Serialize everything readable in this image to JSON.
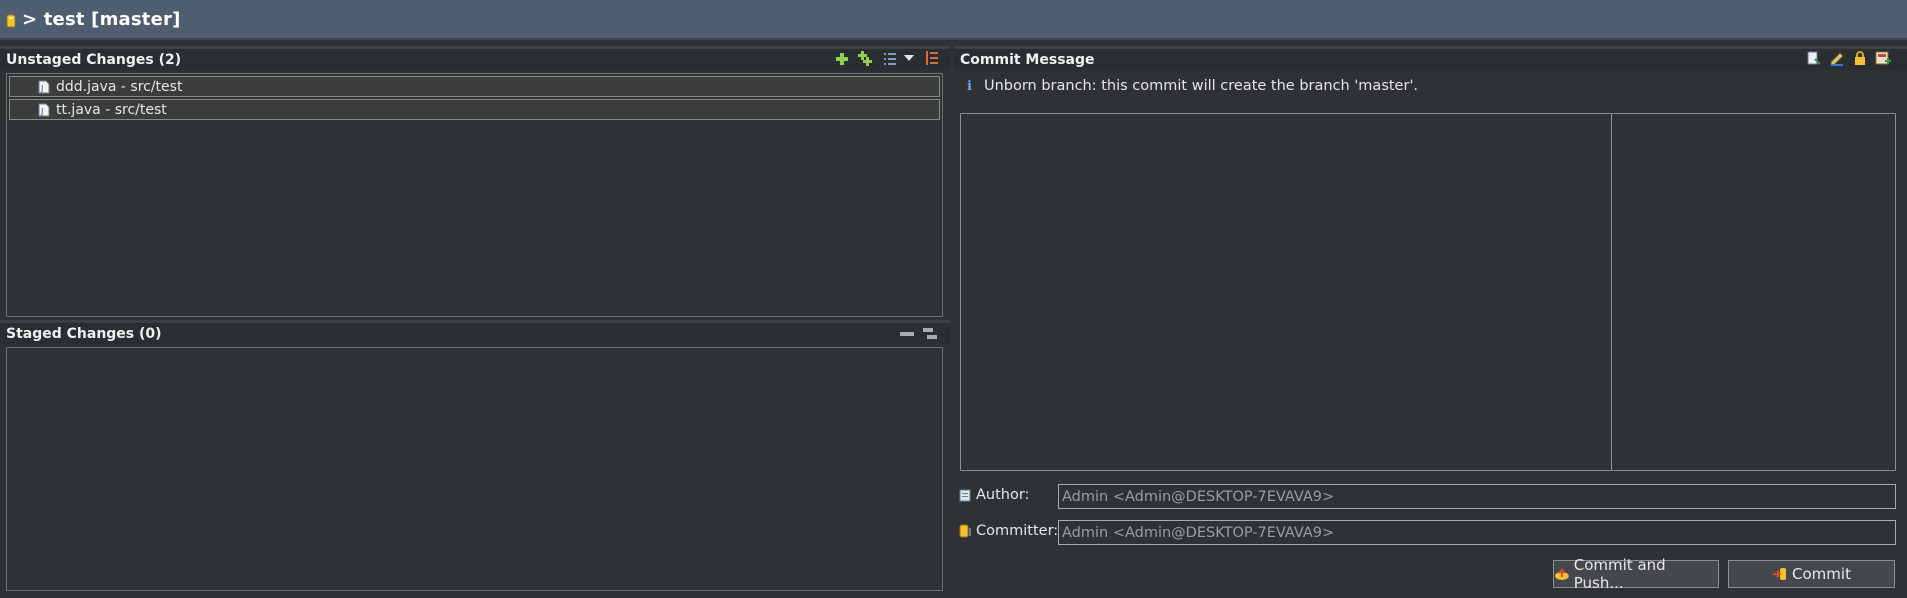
{
  "titlebar": {
    "title": "> test [master]",
    "icon": "repository-icon"
  },
  "unstaged": {
    "title": "Unstaged Changes (2)",
    "files": [
      {
        "name": "ddd.java - src/test",
        "icon": "java-file-icon"
      },
      {
        "name": "tt.java - src/test",
        "icon": "java-file-icon"
      }
    ],
    "toolbar": [
      "add-icon",
      "add-all-icon",
      "list-view-icon",
      "dropdown-icon",
      "presentation-icon"
    ]
  },
  "staged": {
    "title": "Staged Changes (0)",
    "files": [],
    "toolbar": [
      "collapse-icon",
      "expand-icon"
    ]
  },
  "commit": {
    "title": "Commit Message",
    "info": "Unborn branch: this commit will create the branch 'master'.",
    "toolbar": [
      "amend-icon",
      "signoff-icon",
      "sign-icon",
      "change-id-icon"
    ],
    "author_label": "Author:",
    "author_value": "Admin <Admin@DESKTOP-7EVAVA9>",
    "committer_label": "Committer:",
    "committer_value": "Admin <Admin@DESKTOP-7EVAVA9>",
    "commit_push_label": "Commit and Push...",
    "commit_label": "Commit"
  },
  "colors": {
    "titlebar": "#4e5d70",
    "background": "#2f3235",
    "accent_add": "#8fd14f"
  }
}
